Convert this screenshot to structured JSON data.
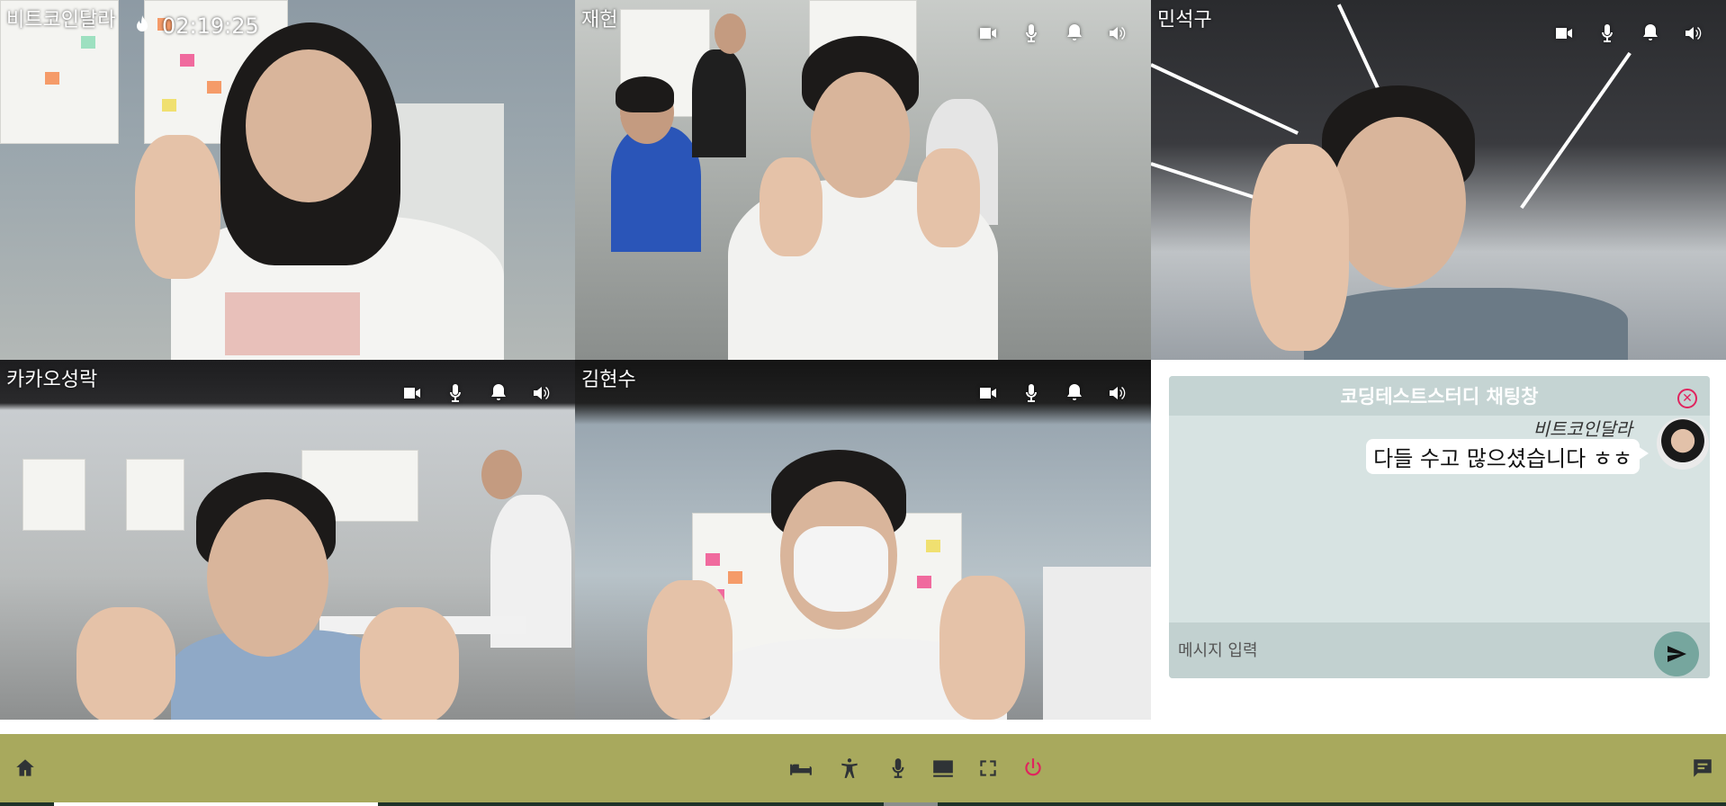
{
  "header": {
    "timer": "02:19:25",
    "timer_icon": "fire-icon"
  },
  "participants": [
    {
      "name": "비트코인달라"
    },
    {
      "name": "재헌"
    },
    {
      "name": "민석구"
    },
    {
      "name": "카카오성락"
    },
    {
      "name": "김현수"
    }
  ],
  "tile_controls": [
    "camera-icon",
    "microphone-icon",
    "bell-icon",
    "speaker-icon"
  ],
  "chat": {
    "title": "코딩테스트스터디 채팅창",
    "messages": [
      {
        "sender": "비트코인달라",
        "text": "다들 수고 많으셨습니다 ㅎㅎ"
      }
    ],
    "input_placeholder": "메시지 입력"
  },
  "toolbar": {
    "left": [
      "home-icon"
    ],
    "center": [
      "bed-icon",
      "accessibility-icon",
      "microphone-icon",
      "screen-share-icon",
      "fullscreen-icon",
      "power-icon"
    ],
    "right": [
      "chat-icon"
    ]
  },
  "colors": {
    "toolbar_bg": "#a8a95d",
    "chat_bg": "#d7e3e2",
    "chat_header_bg": "#c5d4d3",
    "send_button": "#76a69e",
    "power_icon": "#e0245e",
    "close_icon": "#e0245e"
  }
}
